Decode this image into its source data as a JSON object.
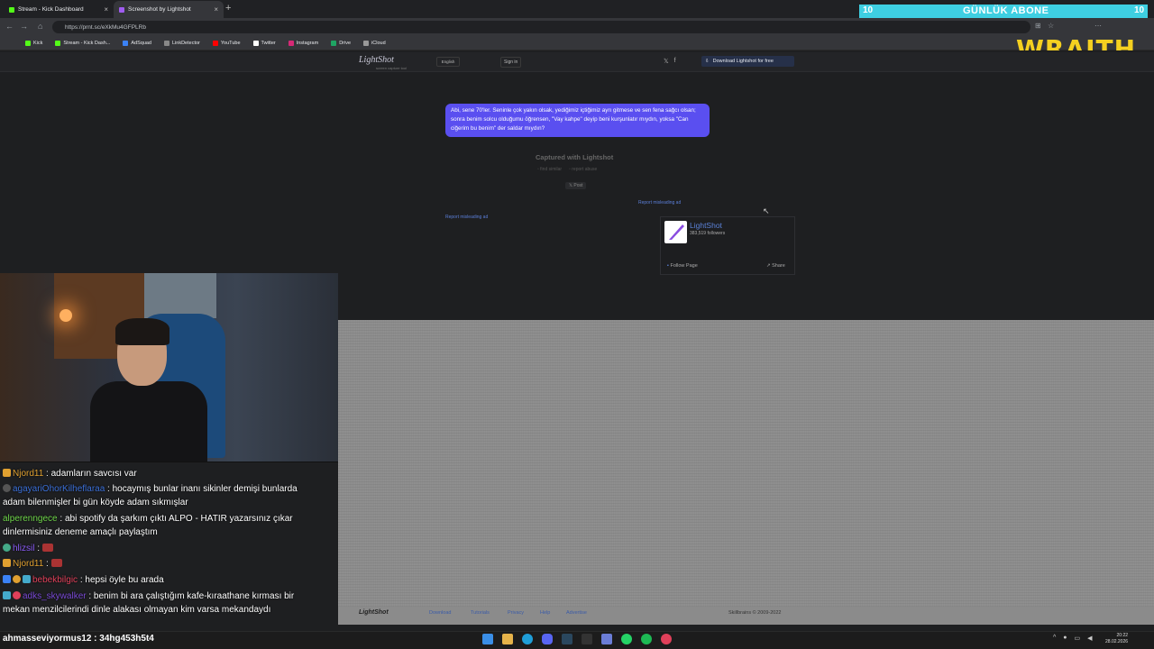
{
  "browser": {
    "tabs": [
      {
        "label": "Stream - Kick Dashboard",
        "color": "#53fc18"
      },
      {
        "label": "Screenshot by Lightshot",
        "color": "#a05cf0"
      }
    ],
    "new_tab": "+",
    "url": "https://prnt.sc/eXkMu4GFPLRb",
    "bookmarks": [
      {
        "label": "Kick",
        "color": "#53fc18"
      },
      {
        "label": "Stream - Kick Dash...",
        "color": "#53fc18"
      },
      {
        "label": "AdSquad",
        "color": "#3b82f6"
      },
      {
        "label": "LinkDetector",
        "color": "#888888"
      },
      {
        "label": "YouTube",
        "color": "#ff0000"
      },
      {
        "label": "Twitter",
        "color": "#ffffff"
      },
      {
        "label": "Instagram",
        "color": "#d62976"
      },
      {
        "label": "Drive",
        "color": "#1fa463"
      },
      {
        "label": "iCloud",
        "color": "#999999"
      }
    ]
  },
  "lightshot": {
    "logo": "LightShot",
    "logo_sub": "screen capture tool",
    "language": "English",
    "signin": "Sign in",
    "social": [
      "twitter-icon",
      "facebook-icon"
    ],
    "download": "Download Lightshot for free",
    "bubble_text": "Abi, sene 70'ler. Seninle çok yakın olsak, yediğimiz içtiğimiz ayrı gitmese ve sen fena sağcı olsan; sonra benim solcu olduğumu öğrensen, \"Vay kahpe\" deyip beni kurşunlatır mıydın, yoksa \"Can ciğerim bu benim\" der saldar mıydın?",
    "captured": "Captured with Lightshot",
    "find_similar": "find similar",
    "report_abuse": "report abuse",
    "post": "Post",
    "report_ad": "Report misleading ad",
    "fb_name": "LightShot",
    "fb_followers": "383,519 followers",
    "fb_follow": "Follow Page",
    "fb_share": "Share",
    "footer_logo": "LightShot",
    "footer_links": [
      "Download",
      "Tutorials",
      "Privacy",
      "Help",
      "Advertise"
    ],
    "footer_copy": "Skillbrains © 2009-2022"
  },
  "chat": [
    {
      "user": "Njord11",
      "color": "#e0a030",
      "text": " : adamların savcısı var"
    },
    {
      "user": "agayariOhorKilheflaraa",
      "color": "#3b6fd6",
      "text": " : hocaymış bunlar inanı sikinler demişi bunlarda adam bilenmişler bi gün köyde adam sıkmışlar"
    },
    {
      "user": "alperenngece",
      "color": "#6fd64a",
      "text": " : abi spotify da şarkım çıktı ALPO - HATIR yazarsınız çıkar dinlermisiniz deneme amaçlı paylaştım"
    },
    {
      "user": "hlizsil",
      "color": "#8a5cf6",
      "text": " : "
    },
    {
      "user": "Njord11",
      "color": "#e0a030",
      "text": " : "
    },
    {
      "user": "bebekbilgic",
      "color": "#e0405a",
      "text": " : hepsi öyle bu arada"
    },
    {
      "user": "adks_skywalker",
      "color": "#7a4ad6",
      "text": " : benim bi ara çalıştığım kafe-kıraathane kırması bir mekan menzilcilerindi dinle alakası olmayan kim varsa mekandaydı"
    }
  ],
  "overlay": {
    "sub_left": "10",
    "sub_text": "GÜNLÜK ABONE",
    "sub_right": "10",
    "brand": "WRAITH"
  },
  "taskbar": {
    "bottom_user": "ahmasseviyormus12 : 34hg453h5t4",
    "time": "20:22",
    "date": "28.02.2026"
  }
}
